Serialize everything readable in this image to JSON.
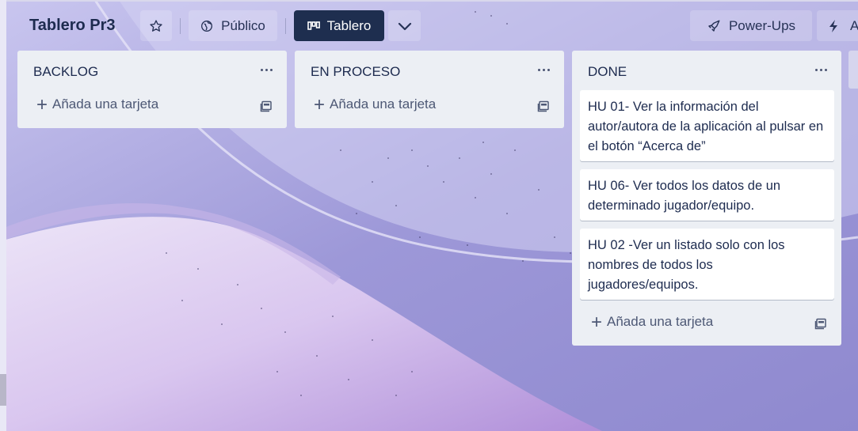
{
  "header": {
    "board_title": "Tablero Pr3",
    "star_icon": "star-icon",
    "visibility_label": "Público",
    "view_label": "Tablero",
    "powerups_label": "Power-Ups",
    "automation_label_partial": "A"
  },
  "lists": [
    {
      "title": "BACKLOG",
      "add_card_label": "Añada una tarjeta",
      "cards": []
    },
    {
      "title": "EN PROCESO",
      "add_card_label": "Añada una tarjeta",
      "cards": []
    },
    {
      "title": "DONE",
      "add_card_label": "Añada una tarjeta",
      "cards": [
        "HU 01- Ver la información del autor/autora de la aplicación al pulsar en el botón “Acerca de”",
        "HU 06- Ver todos los datos de un determinado jugador/equipo.",
        "HU 02 -Ver un listado solo con los nombres de todos los jugadores/equipos."
      ]
    }
  ],
  "colors": {
    "board_button_bg": "#1e2e4f",
    "list_bg": "#eceff4",
    "text": "#1d2b4f",
    "background": "#a8a4db"
  }
}
